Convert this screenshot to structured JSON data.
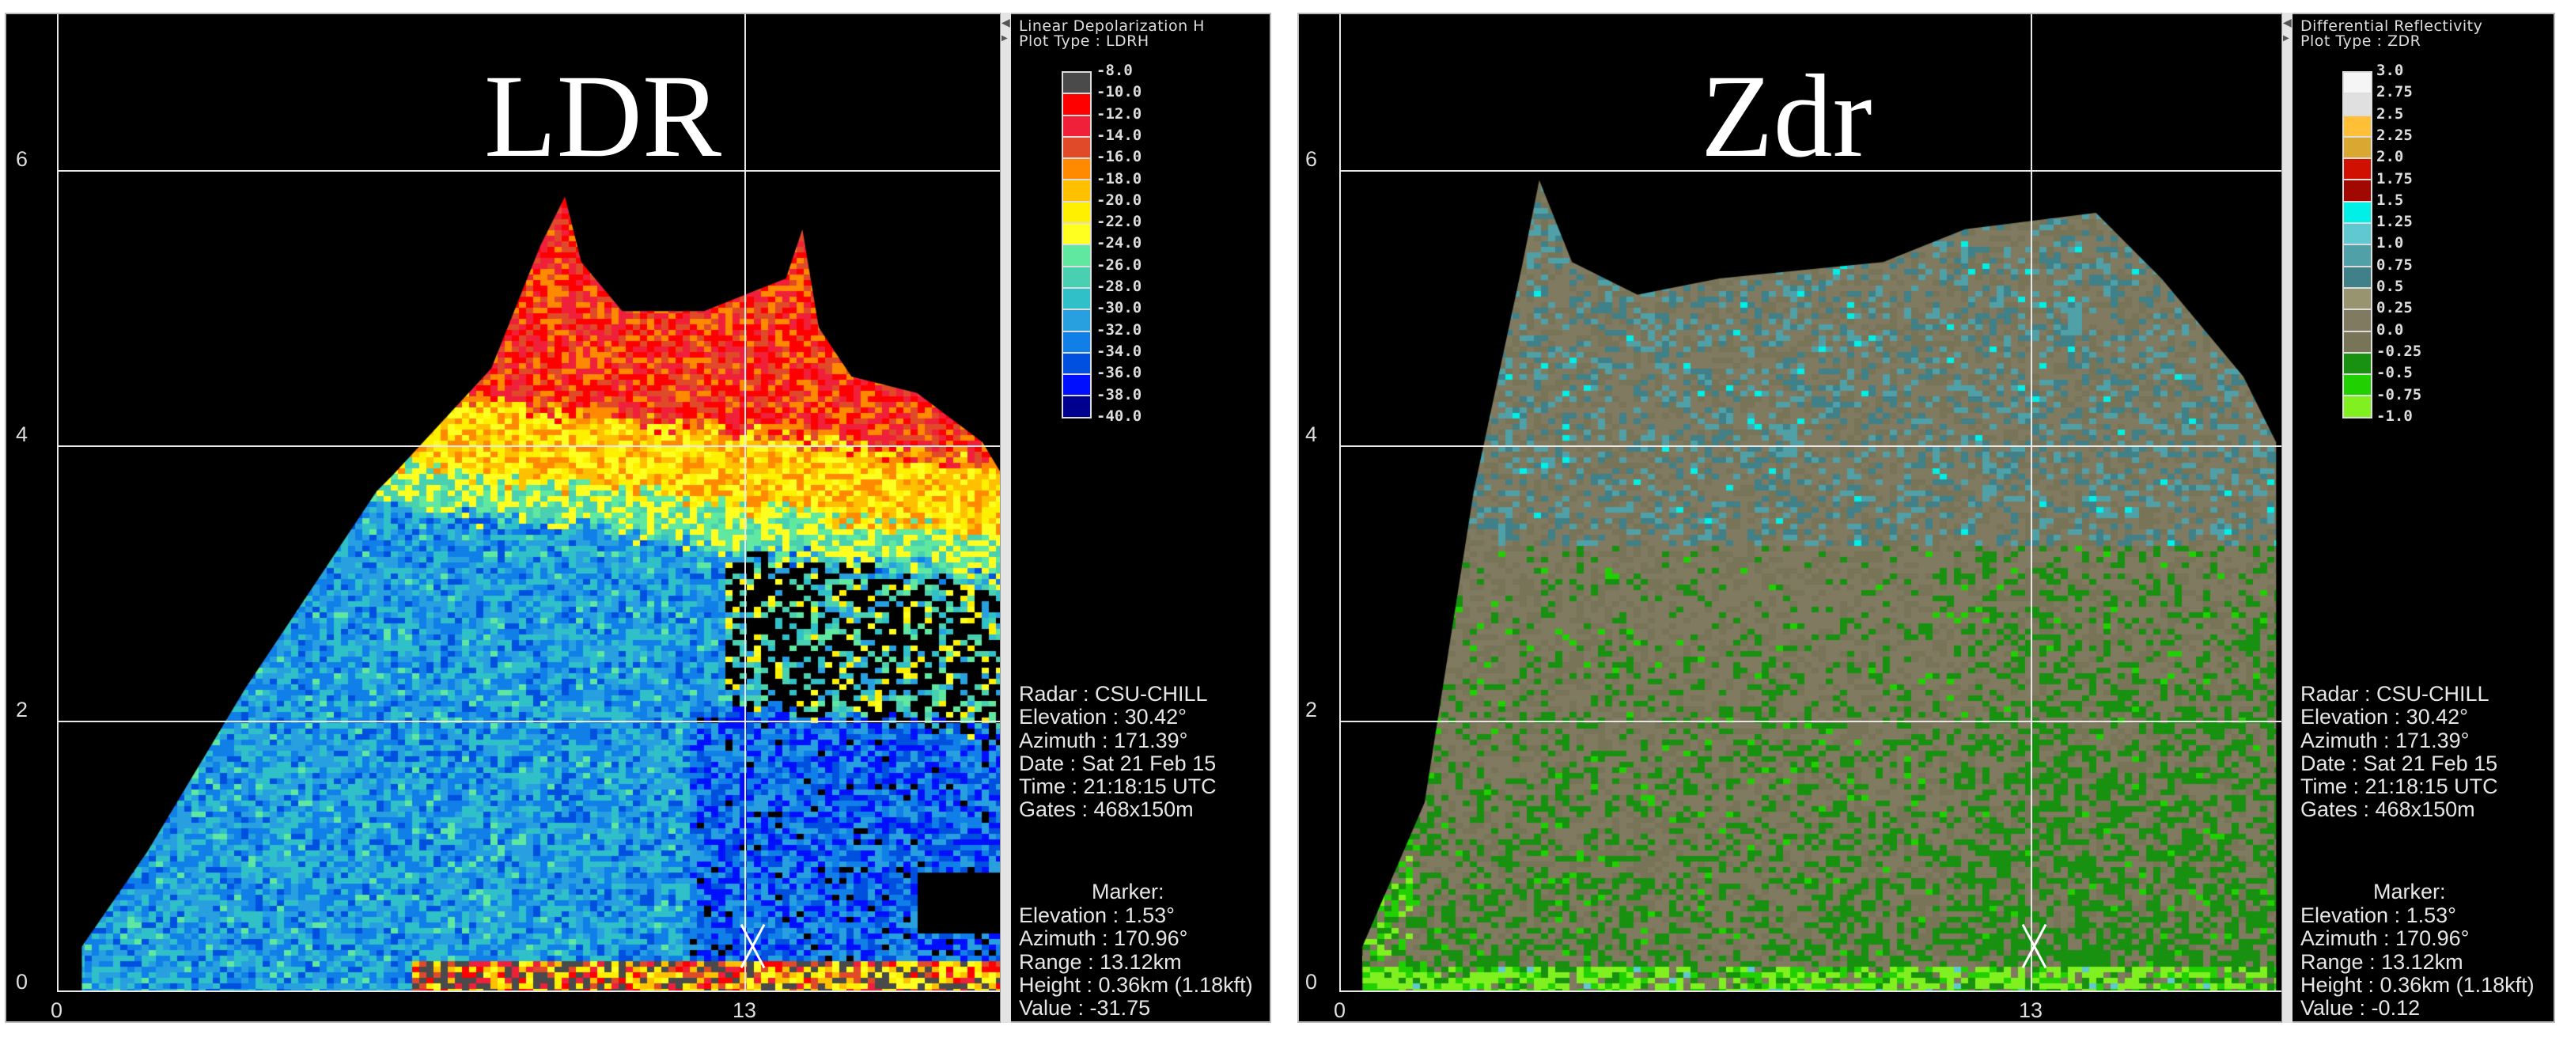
{
  "ldr_panel": {
    "overlay_title": "LDR",
    "y_ticks": [
      "6",
      "4",
      "2",
      "0"
    ],
    "x_ticks": [
      "0",
      "13"
    ],
    "legend": {
      "title_line1": "Linear Depolarization H",
      "title_line2": "Plot Type : LDRH",
      "labels": [
        "-8.0",
        "-10.0",
        "-12.0",
        "-14.0",
        "-16.0",
        "-18.0",
        "-20.0",
        "-22.0",
        "-24.0",
        "-26.0",
        "-28.0",
        "-30.0",
        "-32.0",
        "-34.0",
        "-36.0",
        "-38.0",
        "-40.0"
      ],
      "colors": [
        "#4a4a4a",
        "#ff0000",
        "#f0203a",
        "#e04a28",
        "#ff8a00",
        "#ffc000",
        "#fff000",
        "#ffff20",
        "#60e8a0",
        "#48d0b0",
        "#30c0c8",
        "#28a0e0",
        "#1080e8",
        "#0050e0",
        "#0010ff",
        "#000090"
      ]
    },
    "info": {
      "radar": "Radar : CSU-CHILL",
      "elevation": "Elevation : 30.42°",
      "azimuth": "Azimuth : 171.39°",
      "date": "Date : Sat 21 Feb 15",
      "time": "Time : 21:18:15 UTC",
      "gates": "Gates : 468x150m"
    },
    "marker": {
      "heading": "Marker:",
      "elevation": "Elevation : 1.53°",
      "azimuth": "Azimuth : 170.96°",
      "range": "Range : 13.12km",
      "height": "Height : 0.36km (1.18kft)",
      "value": "Value : -31.75"
    }
  },
  "zdr_panel": {
    "overlay_title": "Zdr",
    "y_ticks": [
      "6",
      "4",
      "2",
      "0"
    ],
    "x_ticks": [
      "0",
      "13"
    ],
    "legend": {
      "title_line1": "Differential Reflectivity",
      "title_line2": "Plot Type : ZDR",
      "labels": [
        "3.0",
        "2.75",
        "2.5",
        "2.25",
        "2.0",
        "1.75",
        "1.5",
        "1.25",
        "1.0",
        "0.75",
        "0.5",
        "0.25",
        "0.0",
        "-0.25",
        "-0.5",
        "-0.75",
        "-1.0"
      ],
      "colors": [
        "#f5f5f5",
        "#e0e0e0",
        "#ffc038",
        "#d8a830",
        "#d01000",
        "#a00800",
        "#00f0e8",
        "#60c8d0",
        "#50a0a8",
        "#408088",
        "#989470",
        "#807a60",
        "#787458",
        "#189010",
        "#20d000",
        "#80f020"
      ]
    },
    "info": {
      "radar": "Radar : CSU-CHILL",
      "elevation": "Elevation : 30.42°",
      "azimuth": "Azimuth : 171.39°",
      "date": "Date : Sat 21 Feb 15",
      "time": "Time : 21:18:15 UTC",
      "gates": "Gates : 468x150m"
    },
    "marker": {
      "heading": "Marker:",
      "elevation": "Elevation : 1.53°",
      "azimuth": "Azimuth : 170.96°",
      "range": "Range : 13.12km",
      "height": "Height : 0.36km (1.18kft)",
      "value": "Value : -0.12"
    }
  }
}
